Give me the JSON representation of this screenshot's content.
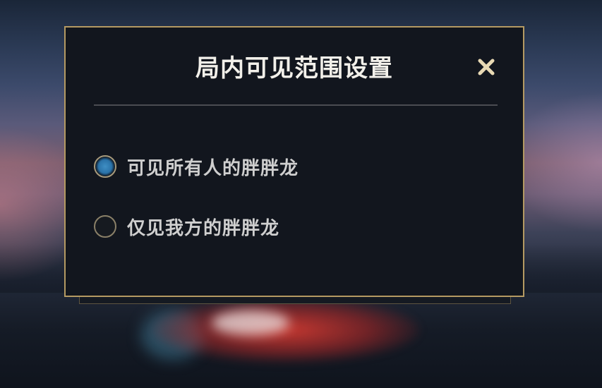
{
  "dialog": {
    "title": "局内可见范围设置",
    "close_icon": "close-icon",
    "options": [
      {
        "label": "可见所有人的胖胖龙",
        "selected": true
      },
      {
        "label": "仅见我方的胖胖龙",
        "selected": false
      }
    ]
  },
  "colors": {
    "dialog_border": "#b49a63",
    "dialog_background": "#12161e",
    "title_text": "#f2f0ea",
    "option_text": "#cfcfcf",
    "radio_selected": "#2a72a8",
    "close_icon": "#e8d9b4"
  }
}
